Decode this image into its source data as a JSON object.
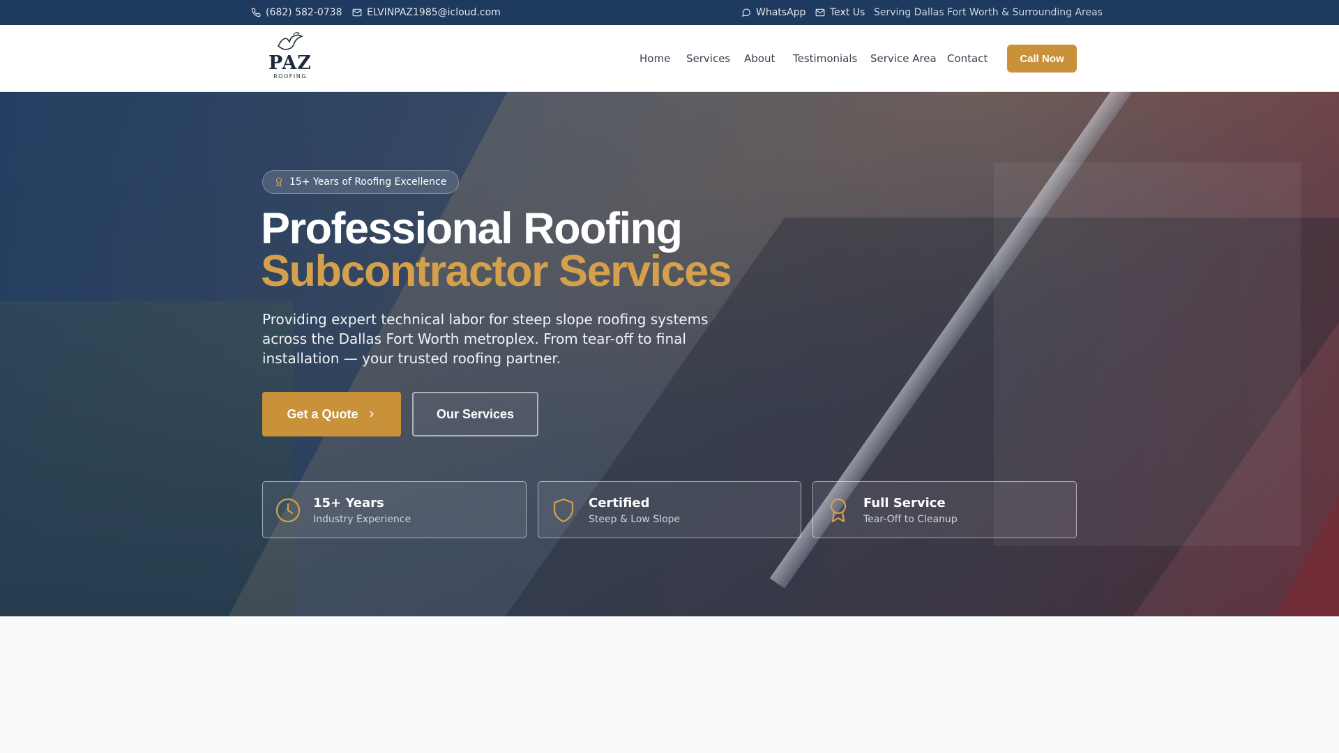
{
  "topbar": {
    "phone": "(682) 582-0738",
    "email": "ELVINPAZ1985@icloud.com",
    "whatsapp": "WhatsApp",
    "text_us": "Text Us",
    "service_area": "Serving Dallas Fort Worth & Surrounding Areas"
  },
  "header": {
    "logo_main": "PAZ",
    "logo_sub": "ROOFING",
    "nav": [
      "Home",
      "Services",
      "About",
      "Testimonials",
      "Service Area",
      "Contact"
    ],
    "cta": "Call Now"
  },
  "hero": {
    "badge": "15+ Years of Roofing Excellence",
    "title_line1": "Professional Roofing",
    "title_line2": "Subcontractor Services",
    "lead": "Providing expert technical labor for steep slope roofing systems across the Dallas Fort Worth metroplex. From tear-off to final installation — your trusted roofing partner.",
    "primary_button": "Get a Quote",
    "secondary_button": "Our Services",
    "features": [
      {
        "title": "15+ Years",
        "subtitle": "Industry Experience",
        "icon": "clock-icon"
      },
      {
        "title": "Certified",
        "subtitle": "Steep & Low Slope",
        "icon": "shield-icon"
      },
      {
        "title": "Full Service",
        "subtitle": "Tear-Off to Cleanup",
        "icon": "award-icon"
      }
    ]
  },
  "colors": {
    "navy": "#1e3a5f",
    "gold": "#c8913a",
    "gold_text": "#d4a04c",
    "page_bg": "#f8fafc"
  }
}
